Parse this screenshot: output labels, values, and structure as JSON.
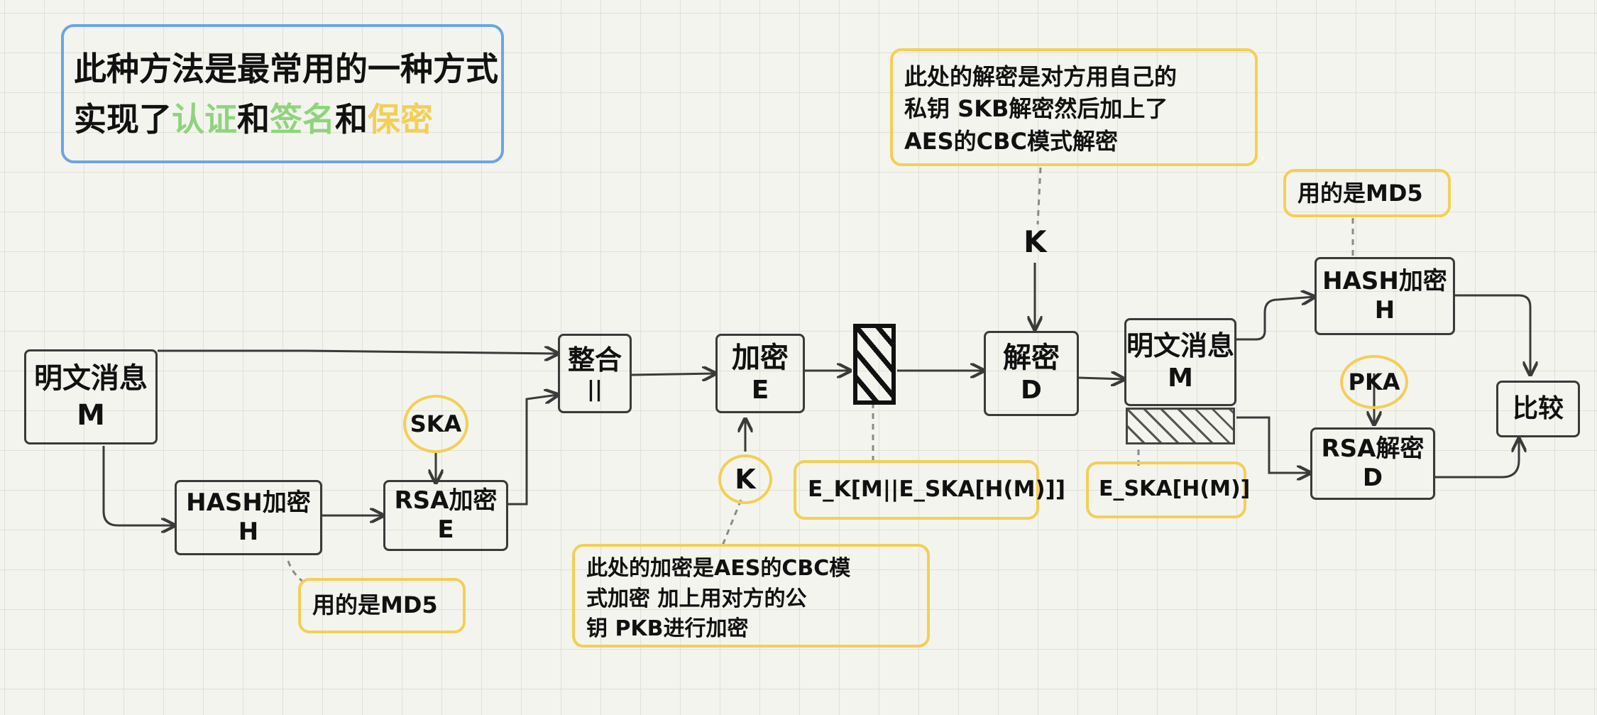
{
  "header": {
    "line1": "此种方法是最常用的一种方式",
    "line2_prefix": "实现了",
    "authentication": "认证",
    "and1": "和",
    "signature": "签名",
    "and2": "和",
    "confidentiality": "保密"
  },
  "nodes": {
    "plaintext_m": {
      "title": "明文消息",
      "sub": "M"
    },
    "hash_h": {
      "title": "HASH加密",
      "sub": "H"
    },
    "rsa_e": {
      "title": "RSA加密",
      "sub": "E"
    },
    "concat": {
      "title": "整合",
      "sub": "||"
    },
    "encrypt_e": {
      "title": "加密",
      "sub": "E"
    },
    "decrypt_d": {
      "title": "解密",
      "sub": "D"
    },
    "plaintext_m2": {
      "title": "明文消息",
      "sub": "M"
    },
    "hash_h2": {
      "title": "HASH加密",
      "sub": "H"
    },
    "rsa_d": {
      "title": "RSA解密",
      "sub": "D"
    },
    "compare": {
      "title": "比较"
    }
  },
  "keys": {
    "ska": "SKA",
    "pka": "PKA",
    "k_encrypt": "K",
    "k_decrypt": "K"
  },
  "labels": {
    "ciphertext": "E_K[M||E_SKA[H(M)]]",
    "signature": "E_SKA[H(M)]"
  },
  "notes": {
    "md5_left": "用的是MD5",
    "md5_right": "用的是MD5",
    "encrypt_note": [
      "此处的加密是AES的CBC模",
      "式加密 加上用对方的公",
      "钥 PKB进行加密"
    ],
    "decrypt_note": [
      "此处的解密是对方用自己的",
      "私钥 SKB解密然后加上了",
      "AES的CBC模式解密"
    ]
  },
  "colors": {
    "note_border": "#f2cf58",
    "header_border": "#6ea3e6",
    "highlight_green": "#8ed47c",
    "highlight_yellow": "#f2cf58",
    "ink": "#111111"
  }
}
